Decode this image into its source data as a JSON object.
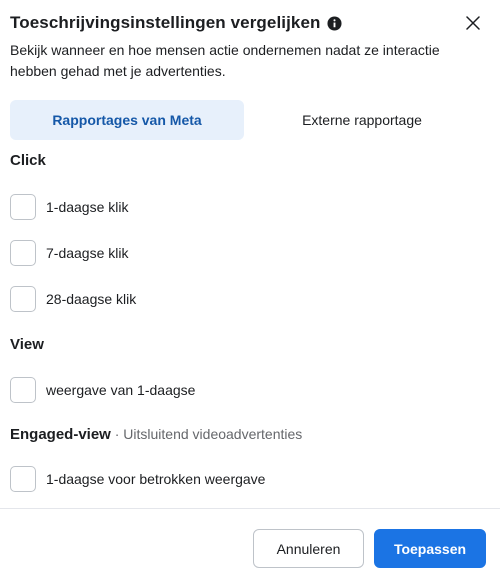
{
  "dialog": {
    "title": "Toeschrijvingsinstellingen vergelijken",
    "info_icon": "info-circle-icon",
    "close_icon": "close-icon",
    "description": "Bekijk wanneer en hoe mensen actie ondernemen nadat ze interactie hebben gehad met je advertenties."
  },
  "tabs": [
    {
      "label": "Rapportages van Meta",
      "active": true
    },
    {
      "label": "Externe rapportage",
      "active": false
    }
  ],
  "sections": {
    "click": {
      "title": "Click",
      "options": [
        {
          "label": "1-daagse klik",
          "checked": false
        },
        {
          "label": "7-daagse klik",
          "checked": false
        },
        {
          "label": "28-daagse klik",
          "checked": false
        }
      ]
    },
    "view": {
      "title": "View",
      "options": [
        {
          "label": "weergave van 1-daagse",
          "checked": false
        }
      ]
    },
    "engaged_view": {
      "title": "Engaged-view",
      "note": " · Uitsluitend videoadvertenties",
      "options": [
        {
          "label": "1-daagse voor betrokken weergave",
          "checked": false
        }
      ]
    }
  },
  "footer": {
    "cancel_label": "Annuleren",
    "apply_label": "Toepassen"
  },
  "colors": {
    "accent": "#1b74e4",
    "active_tab_bg": "#e7f0fb",
    "active_tab_text": "#1558a8"
  }
}
